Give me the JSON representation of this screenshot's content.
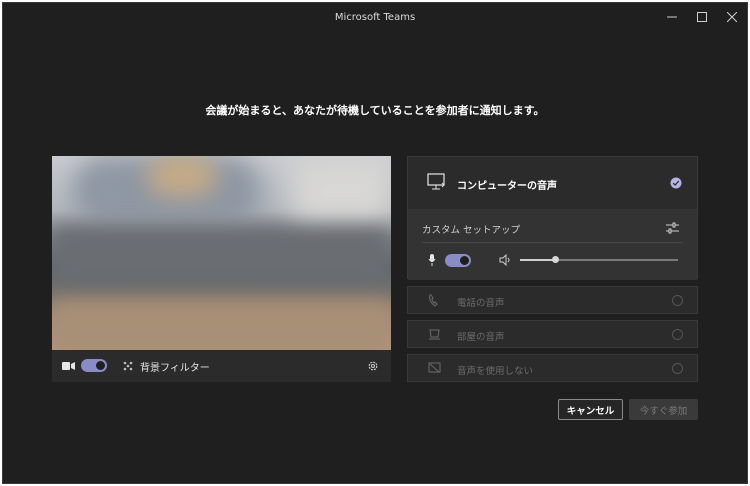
{
  "window": {
    "title": "Microsoft Teams"
  },
  "heading": "会議が始まると、あなたが待機していることを参加者に通知します。",
  "video_bar": {
    "camera_on": true,
    "background_filter_label": "背景フィルター"
  },
  "audio": {
    "computer_audio_label": "コンピューターの音声",
    "custom_setup_label": "カスタム セットアップ",
    "mic_on": true,
    "speaker_volume": 0.22,
    "options": [
      {
        "label": "電話の音声",
        "icon": "phone-icon"
      },
      {
        "label": "部屋の音声",
        "icon": "room-icon"
      },
      {
        "label": "音声を使用しない",
        "icon": "no-audio-icon"
      }
    ]
  },
  "buttons": {
    "cancel": "キャンセル",
    "join": "今すぐ参加"
  },
  "colors": {
    "accent": "#8b8cc7",
    "background": "#1f1f1f",
    "panel": "#2b2b2b"
  }
}
